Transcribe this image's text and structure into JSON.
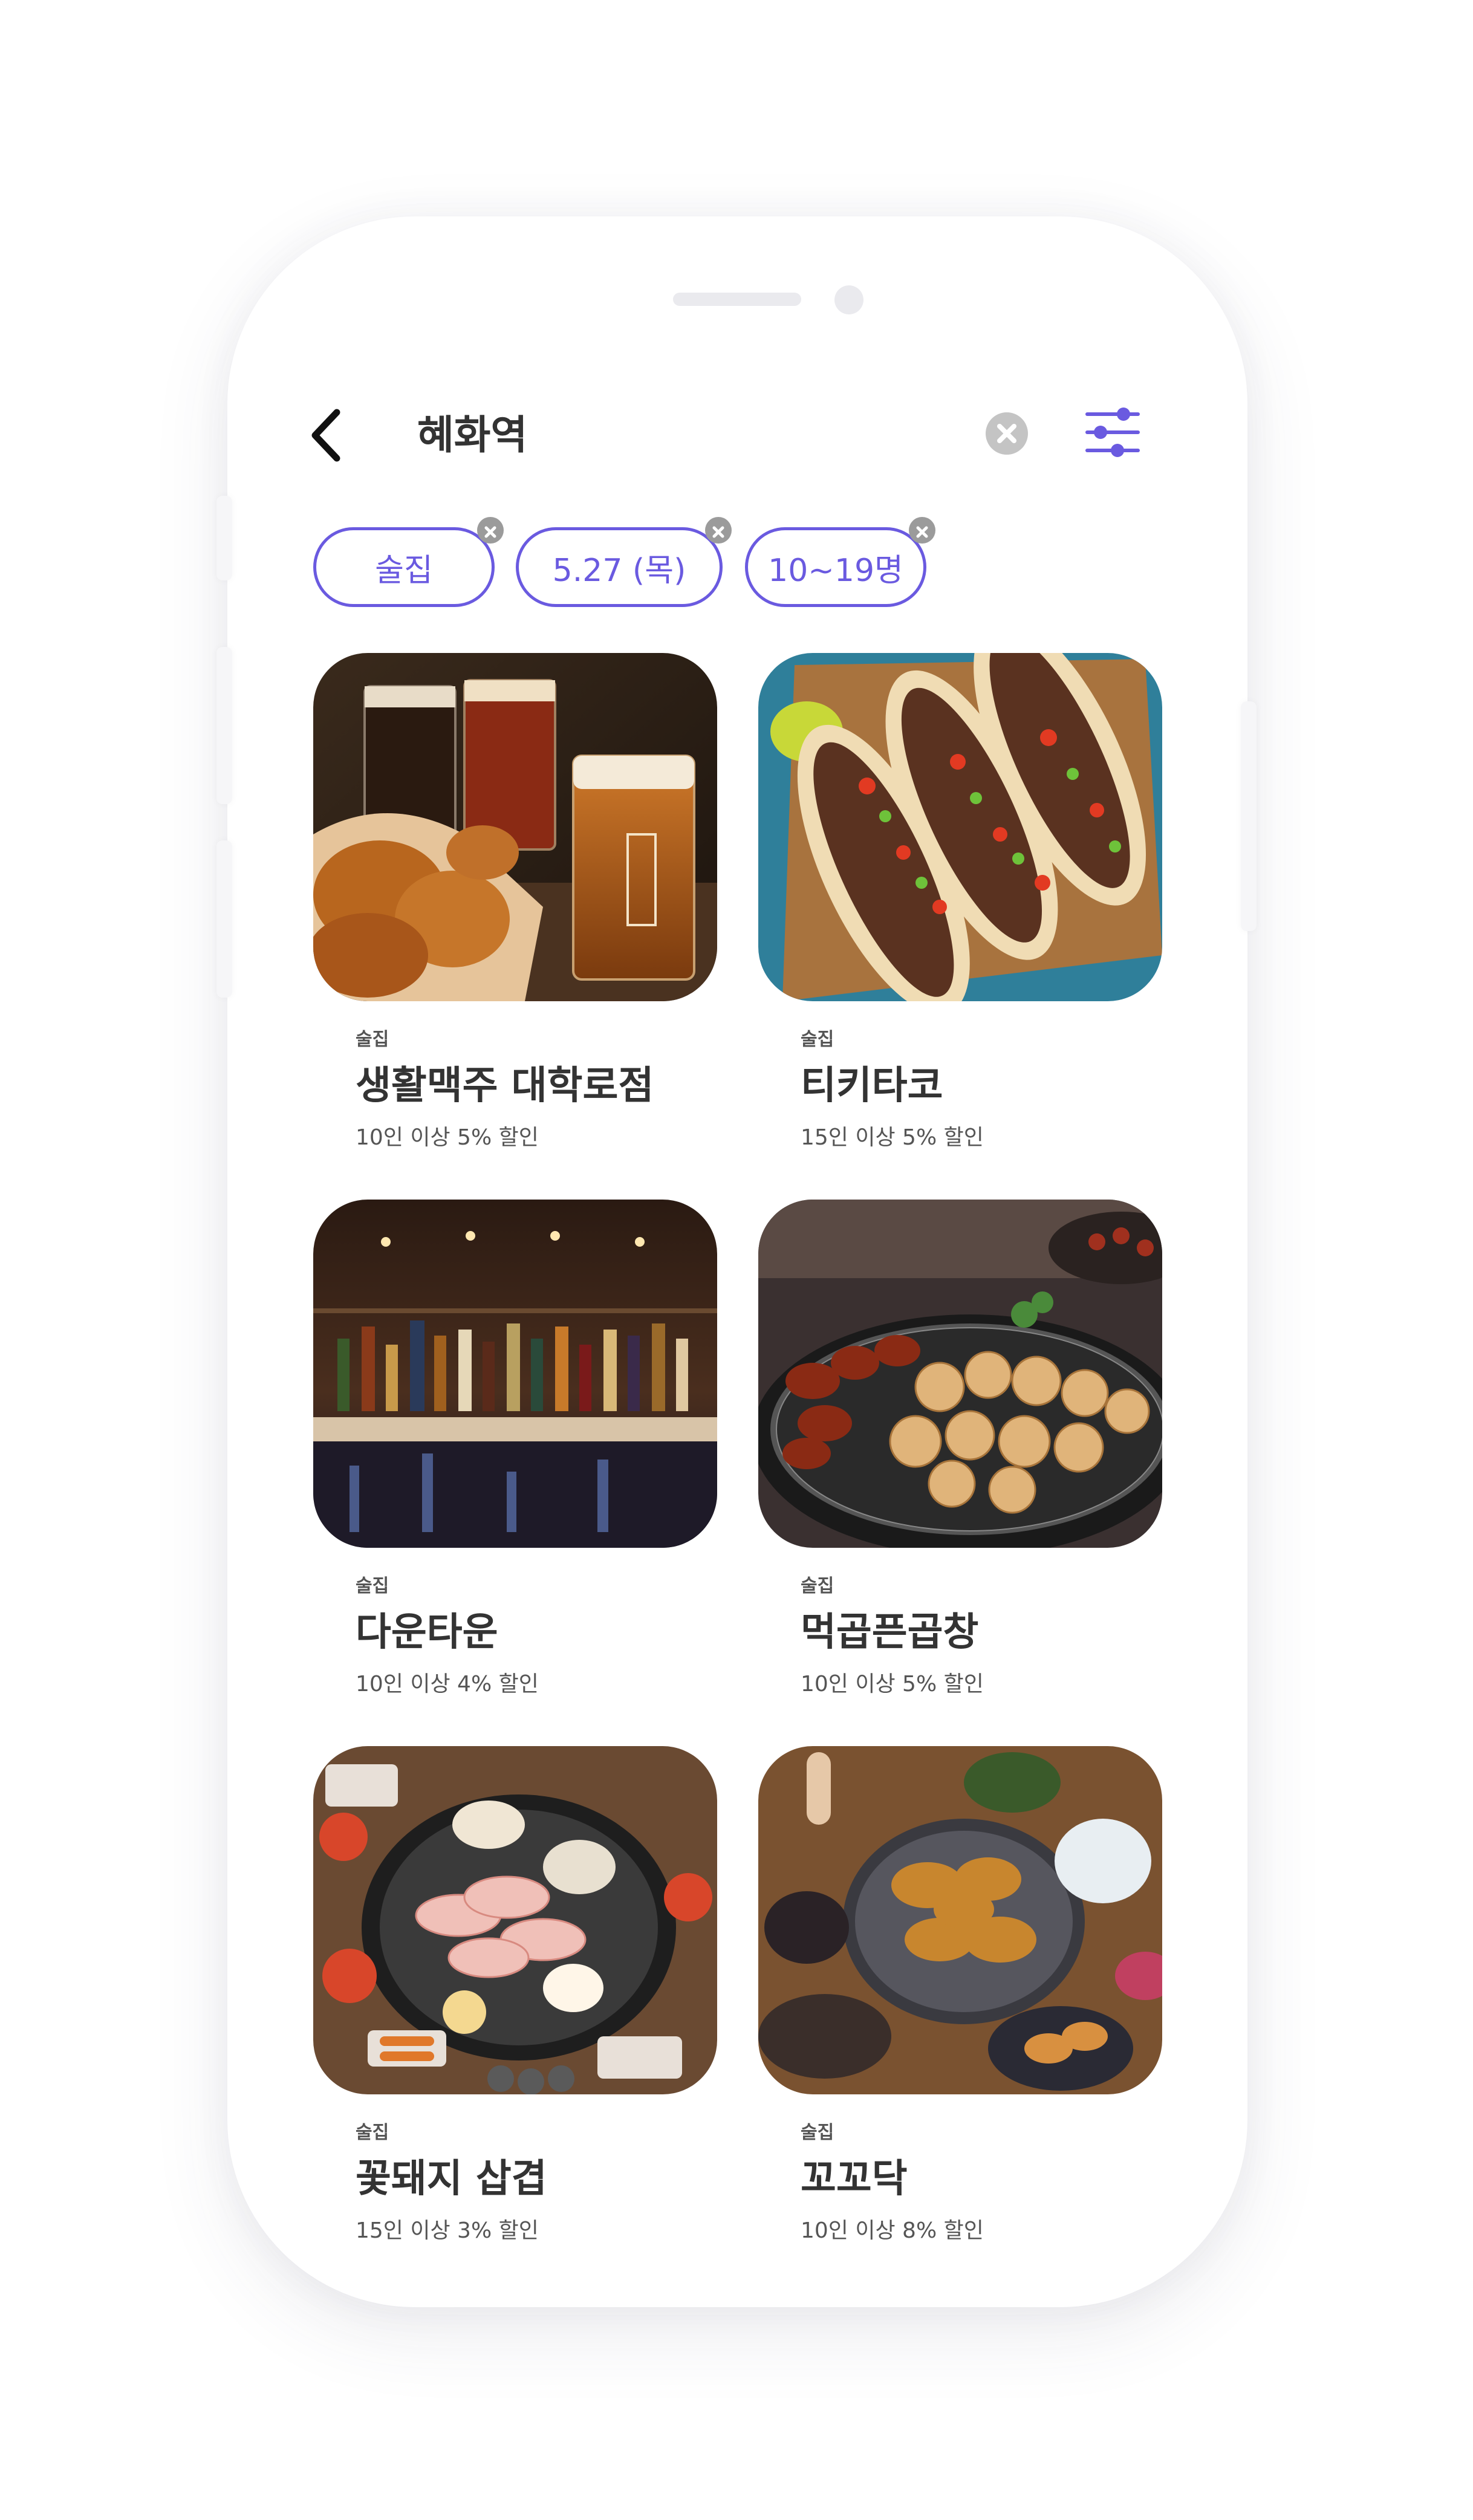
{
  "search": {
    "query": "혜화역"
  },
  "icons": {
    "back": "chevron-left-icon",
    "clear": "close-circle-icon",
    "filter": "sliders-icon",
    "chip_remove": "close-icon"
  },
  "colors": {
    "accent": "#6a5ae0",
    "text": "#333333",
    "muted": "#555555"
  },
  "filters": [
    {
      "label": "술집"
    },
    {
      "label": "5.27 (목)"
    },
    {
      "label": "10~19명"
    }
  ],
  "results": [
    {
      "category": "술집",
      "name": "생활맥주 대학로점",
      "discount": "10인 이상 5% 할인"
    },
    {
      "category": "술집",
      "name": "티키타코",
      "discount": "15인 이상 5% 할인"
    },
    {
      "category": "술집",
      "name": "다운타운",
      "discount": "10인 이상 4% 할인"
    },
    {
      "category": "술집",
      "name": "먹곱픈곱창",
      "discount": "10인 이상 5% 할인"
    },
    {
      "category": "술집",
      "name": "꽃돼지 삽겹",
      "discount": "15인 이상 3% 할인"
    },
    {
      "category": "술집",
      "name": "꼬꼬닥",
      "discount": "10인 이상 8% 할인"
    }
  ]
}
